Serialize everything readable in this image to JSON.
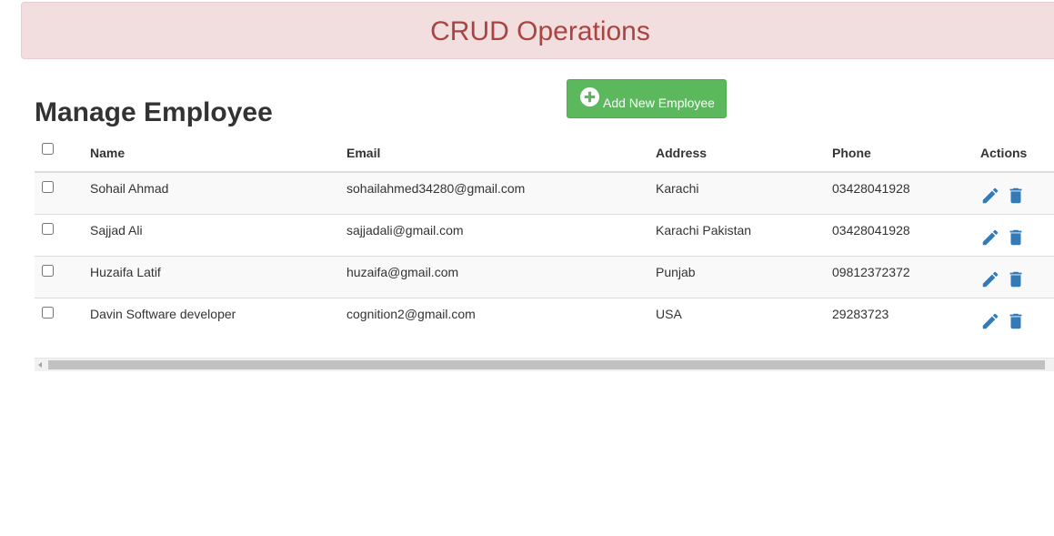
{
  "banner": {
    "title": "CRUD Operations"
  },
  "page": {
    "heading": "Manage Employee",
    "add_button_label": "Add New Employee"
  },
  "table": {
    "columns": [
      "Name",
      "Email",
      "Address",
      "Phone",
      "Actions"
    ],
    "rows": [
      {
        "name": "Sohail Ahmad",
        "email": "sohailahmed34280@gmail.com",
        "address": "Karachi",
        "phone": "03428041928"
      },
      {
        "name": "Sajjad Ali",
        "email": "sajjadali@gmail.com",
        "address": "Karachi Pakistan",
        "phone": "03428041928"
      },
      {
        "name": "Huzaifa Latif",
        "email": "huzaifa@gmail.com",
        "address": "Punjab",
        "phone": "09812372372"
      },
      {
        "name": "Davin Software developer",
        "email": "cognition2@gmail.com",
        "address": "USA",
        "phone": "29283723"
      }
    ]
  },
  "icons": {
    "add": "plus-circle-icon",
    "edit": "pencil-icon",
    "delete": "trash-icon"
  },
  "colors": {
    "banner_bg": "#f2dede",
    "banner_text": "#a94442",
    "button_green": "#5cb85c",
    "action_blue": "#337ab7"
  }
}
